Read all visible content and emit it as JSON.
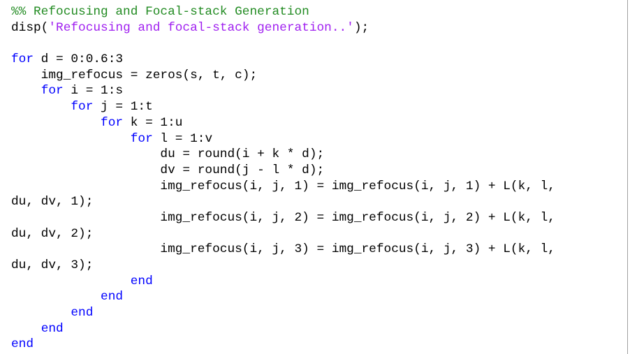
{
  "colors": {
    "background": "#ffffff",
    "text": "#000000",
    "comment": "#228b22",
    "keyword": "#0000ff",
    "string": "#a020f0",
    "border": "#a0a0a0"
  },
  "code_lines": [
    [
      {
        "t": "comment",
        "v": "%% Refocusing and Focal-stack Generation"
      }
    ],
    [
      {
        "t": "plain",
        "v": "disp("
      },
      {
        "t": "str",
        "v": "'Refocusing and focal-stack generation..'"
      },
      {
        "t": "plain",
        "v": ");"
      }
    ],
    [],
    [
      {
        "t": "kw",
        "v": "for"
      },
      {
        "t": "plain",
        "v": " d = 0:0.6:3"
      }
    ],
    [
      {
        "t": "plain",
        "v": "    img_refocus = zeros(s, t, c);"
      }
    ],
    [
      {
        "t": "plain",
        "v": "    "
      },
      {
        "t": "kw",
        "v": "for"
      },
      {
        "t": "plain",
        "v": " i = 1:s"
      }
    ],
    [
      {
        "t": "plain",
        "v": "        "
      },
      {
        "t": "kw",
        "v": "for"
      },
      {
        "t": "plain",
        "v": " j = 1:t"
      }
    ],
    [
      {
        "t": "plain",
        "v": "            "
      },
      {
        "t": "kw",
        "v": "for"
      },
      {
        "t": "plain",
        "v": " k = 1:u"
      }
    ],
    [
      {
        "t": "plain",
        "v": "                "
      },
      {
        "t": "kw",
        "v": "for"
      },
      {
        "t": "plain",
        "v": " l = 1:v"
      }
    ],
    [
      {
        "t": "plain",
        "v": "                    du = round(i + k * d);"
      }
    ],
    [
      {
        "t": "plain",
        "v": "                    dv = round(j - l * d);"
      }
    ],
    [
      {
        "t": "plain",
        "v": "                    img_refocus(i, j, 1) = img_refocus(i, j, 1) + L(k, l,"
      }
    ],
    [
      {
        "t": "plain",
        "v": "du, dv, 1);"
      }
    ],
    [
      {
        "t": "plain",
        "v": "                    img_refocus(i, j, 2) = img_refocus(i, j, 2) + L(k, l,"
      }
    ],
    [
      {
        "t": "plain",
        "v": "du, dv, 2);"
      }
    ],
    [
      {
        "t": "plain",
        "v": "                    img_refocus(i, j, 3) = img_refocus(i, j, 3) + L(k, l,"
      }
    ],
    [
      {
        "t": "plain",
        "v": "du, dv, 3);"
      }
    ],
    [
      {
        "t": "plain",
        "v": "                "
      },
      {
        "t": "kw",
        "v": "end"
      }
    ],
    [
      {
        "t": "plain",
        "v": "            "
      },
      {
        "t": "kw",
        "v": "end"
      }
    ],
    [
      {
        "t": "plain",
        "v": "        "
      },
      {
        "t": "kw",
        "v": "end"
      }
    ],
    [
      {
        "t": "plain",
        "v": "    "
      },
      {
        "t": "kw",
        "v": "end"
      }
    ],
    [
      {
        "t": "kw",
        "v": "end"
      }
    ]
  ]
}
